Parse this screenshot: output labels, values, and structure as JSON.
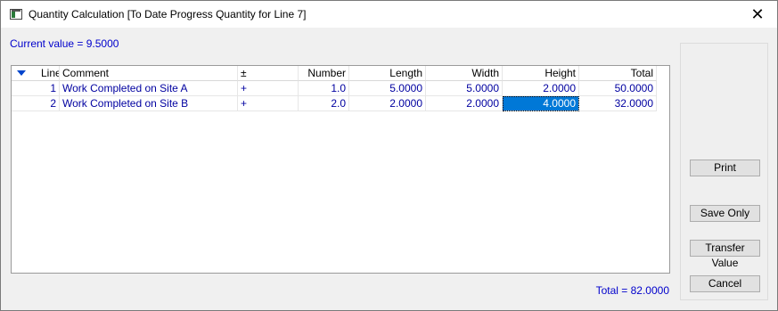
{
  "window": {
    "title": "Quantity Calculation [To Date Progress Quantity for Line 7]",
    "close_glyph": "✕",
    "app_icon": "window-app-icon"
  },
  "current_value": "Current value = 9.5000",
  "grid": {
    "columns": {
      "line": "Line",
      "comment": "Comment",
      "sign": "±",
      "number": "Number",
      "length": "Length",
      "width": "Width",
      "height": "Height",
      "total": "Total"
    },
    "sort_icon": "sort-down-triangle-icon",
    "rows": [
      {
        "line": "1",
        "comment": "Work Completed on Site A",
        "sign": "+",
        "number": "1.0",
        "length": "5.0000",
        "width": "5.0000",
        "height": "2.0000",
        "total": "50.0000"
      },
      {
        "line": "2",
        "comment": "Work Completed on Site B",
        "sign": "+",
        "number": "2.0",
        "length": "2.0000",
        "width": "2.0000",
        "height": "4.0000",
        "total": "32.0000"
      }
    ]
  },
  "buttons": {
    "print": "Print",
    "save_only": "Save Only",
    "transfer_value": "Transfer Value",
    "cancel": "Cancel"
  },
  "total": "Total = 82.0000",
  "colors": {
    "accent_text": "#0000cc",
    "selection": "#0078d7"
  }
}
